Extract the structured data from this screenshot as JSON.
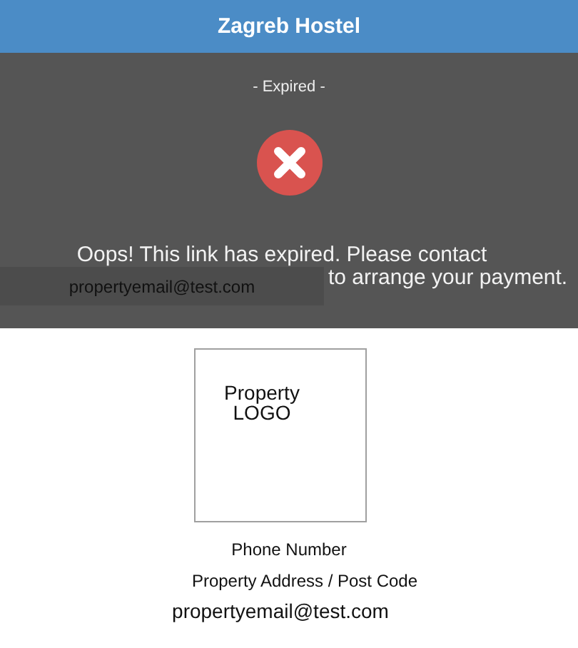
{
  "header": {
    "title": "Zagreb Hostel"
  },
  "notice": {
    "status": "- Expired -",
    "message_start": "Oops! This link has expired. Please contact",
    "contact_email": "propertyemail@test.com",
    "message_end": "to arrange your payment."
  },
  "property": {
    "logo_text": "Property LOGO",
    "phone": "Phone Number",
    "address": "Property Address / Post Code",
    "email": "propertyemail@test.com"
  }
}
